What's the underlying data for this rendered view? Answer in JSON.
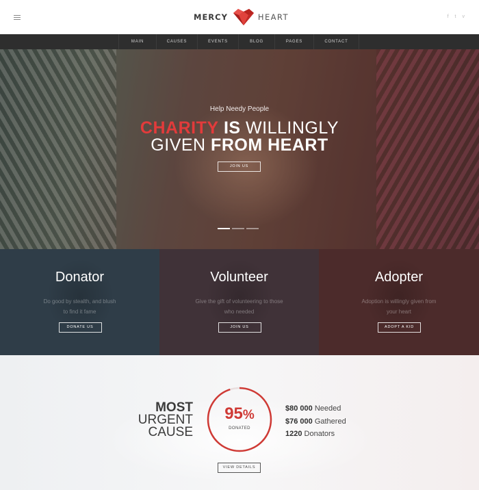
{
  "header": {
    "logo_word1": "MERCY",
    "logo_word2": "HEART",
    "menu_icon": "hamburger-icon",
    "social": [
      {
        "icon": "facebook-icon",
        "glyph": "f"
      },
      {
        "icon": "twitter-icon",
        "glyph": "t"
      },
      {
        "icon": "vimeo-icon",
        "glyph": "v"
      }
    ]
  },
  "nav": {
    "items": [
      {
        "label": "MAIN"
      },
      {
        "label": "CAUSES"
      },
      {
        "label": "EVENTS"
      },
      {
        "label": "BLOG"
      },
      {
        "label": "PAGES"
      },
      {
        "label": "CONTACT"
      }
    ]
  },
  "hero": {
    "subtitle": "Help Needy People",
    "line1_accent": "CHARITY",
    "line1_bold": "IS",
    "line1_light": "WILLINGLY",
    "line2_light": "GIVEN",
    "line2_bold": "FROM HEART",
    "button": "JOIN US",
    "slides": 3,
    "active_slide": 1
  },
  "panels": [
    {
      "title": "Donator",
      "text1": "Do good by stealth, and blush",
      "text2": "to find it fame",
      "button": "DONATE US"
    },
    {
      "title": "Volunteer",
      "text1": "Give the gift of volunteering to those",
      "text2": "who needed",
      "button": "JOIN US"
    },
    {
      "title": "Adopter",
      "text1": "Adoption is willingly given from",
      "text2": "your heart",
      "button": "ADOPT A KID"
    }
  ],
  "cause": {
    "title1": "MOST",
    "title2": "URGENT",
    "title3": "CAUSE",
    "percent": 95,
    "percent_number": "95",
    "percent_sign": "%",
    "percent_label": "DONATED",
    "needed_value": "$80 000",
    "needed_label": "Needed",
    "gathered_value": "$76 000",
    "gathered_label": "Gathered",
    "donators_value": "1220",
    "donators_label": "Donators",
    "button": "VIEW DETAILS"
  },
  "colors": {
    "accent": "#e23b3b",
    "nav_bg": "#2e2e2e",
    "donator_bg": "#2f3d48",
    "volunteer_bg": "#403238",
    "adopter_bg": "#4c2b2b",
    "ring": "#cf3a35"
  }
}
